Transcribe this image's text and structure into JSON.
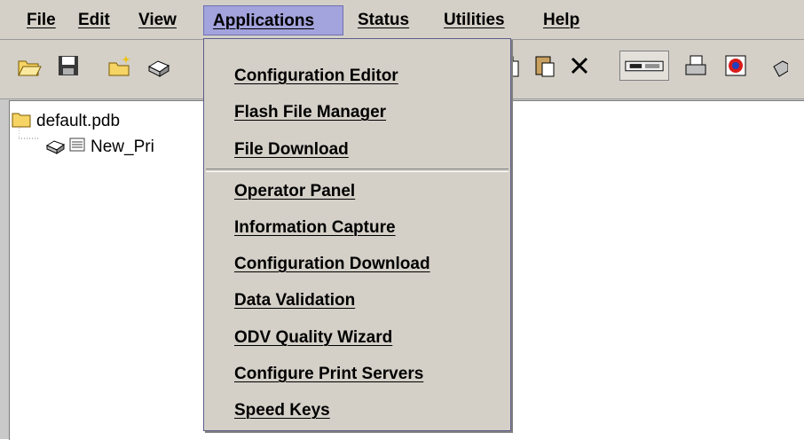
{
  "menubar": {
    "items": [
      {
        "label": "File"
      },
      {
        "label": "Edit"
      },
      {
        "label": "View"
      },
      {
        "label": "Applications",
        "active": true
      },
      {
        "label": "Status"
      },
      {
        "label": "Utilities"
      },
      {
        "label": "Help"
      }
    ]
  },
  "toolbar": {
    "icons": [
      "open-folder-icon",
      "save-icon",
      "new-folder-icon",
      "new-printer-icon",
      "copy-icon",
      "paste-icon",
      "delete-icon",
      "device-icon",
      "print-queue-icon",
      "app-icon",
      "extra-icon"
    ]
  },
  "tree": {
    "root": {
      "label": "default.pdb",
      "icon": "folder-icon"
    },
    "child": {
      "label": "New_Pri",
      "icon": "printer-icon"
    }
  },
  "applications_menu": {
    "group1": [
      {
        "label": "Configuration Editor"
      },
      {
        "label": "Flash File Manager"
      },
      {
        "label": "File Download"
      }
    ],
    "group2": [
      {
        "label": "Operator Panel"
      },
      {
        "label": "Information Capture"
      },
      {
        "label": "Configuration Download"
      },
      {
        "label": "Data Validation"
      },
      {
        "label": "ODV Quality Wizard"
      },
      {
        "label": "Configure Print Servers"
      },
      {
        "label": "Speed Keys"
      }
    ]
  },
  "colors": {
    "menu_highlight": "#a3a3dd",
    "chrome": "#d4d0c8",
    "folder_yellow": "#f6d465"
  }
}
